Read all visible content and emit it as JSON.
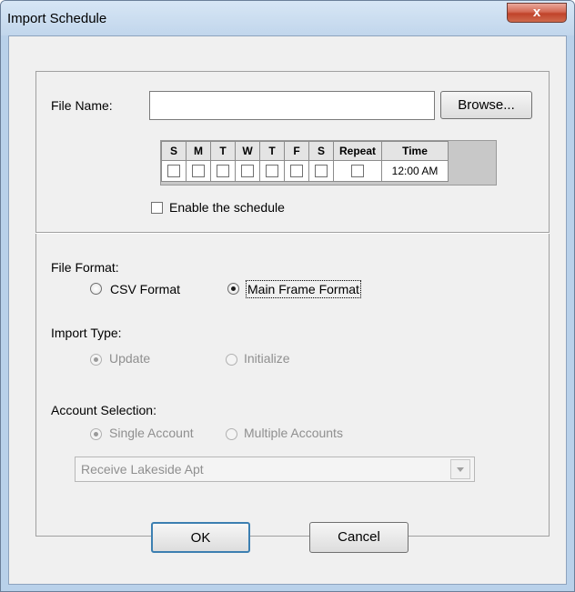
{
  "window": {
    "title": "Import Schedule",
    "close_label": "x"
  },
  "file": {
    "label": "File Name:",
    "value": "",
    "browse_label": "Browse..."
  },
  "schedule": {
    "headers": [
      "S",
      "M",
      "T",
      "W",
      "T",
      "F",
      "S",
      "Repeat",
      "Time"
    ],
    "time_value": "12:00 AM",
    "days_checked": [
      false,
      false,
      false,
      false,
      false,
      false,
      false
    ],
    "repeat_checked": false
  },
  "enable": {
    "label": "Enable the schedule",
    "checked": false
  },
  "file_format": {
    "label": "File Format:",
    "options": [
      {
        "label": "CSV Format",
        "selected": false
      },
      {
        "label": "Main Frame Format",
        "selected": true
      }
    ]
  },
  "import_type": {
    "label": "Import Type:",
    "options": [
      {
        "label": "Update",
        "selected": true
      },
      {
        "label": "Initialize",
        "selected": false
      }
    ]
  },
  "account_selection": {
    "label": "Account Selection:",
    "options": [
      {
        "label": "Single Account",
        "selected": true
      },
      {
        "label": "Multiple Accounts",
        "selected": false
      }
    ],
    "account_value": "Receive Lakeside Apt"
  },
  "buttons": {
    "ok_label": "OK",
    "cancel_label": "Cancel"
  }
}
